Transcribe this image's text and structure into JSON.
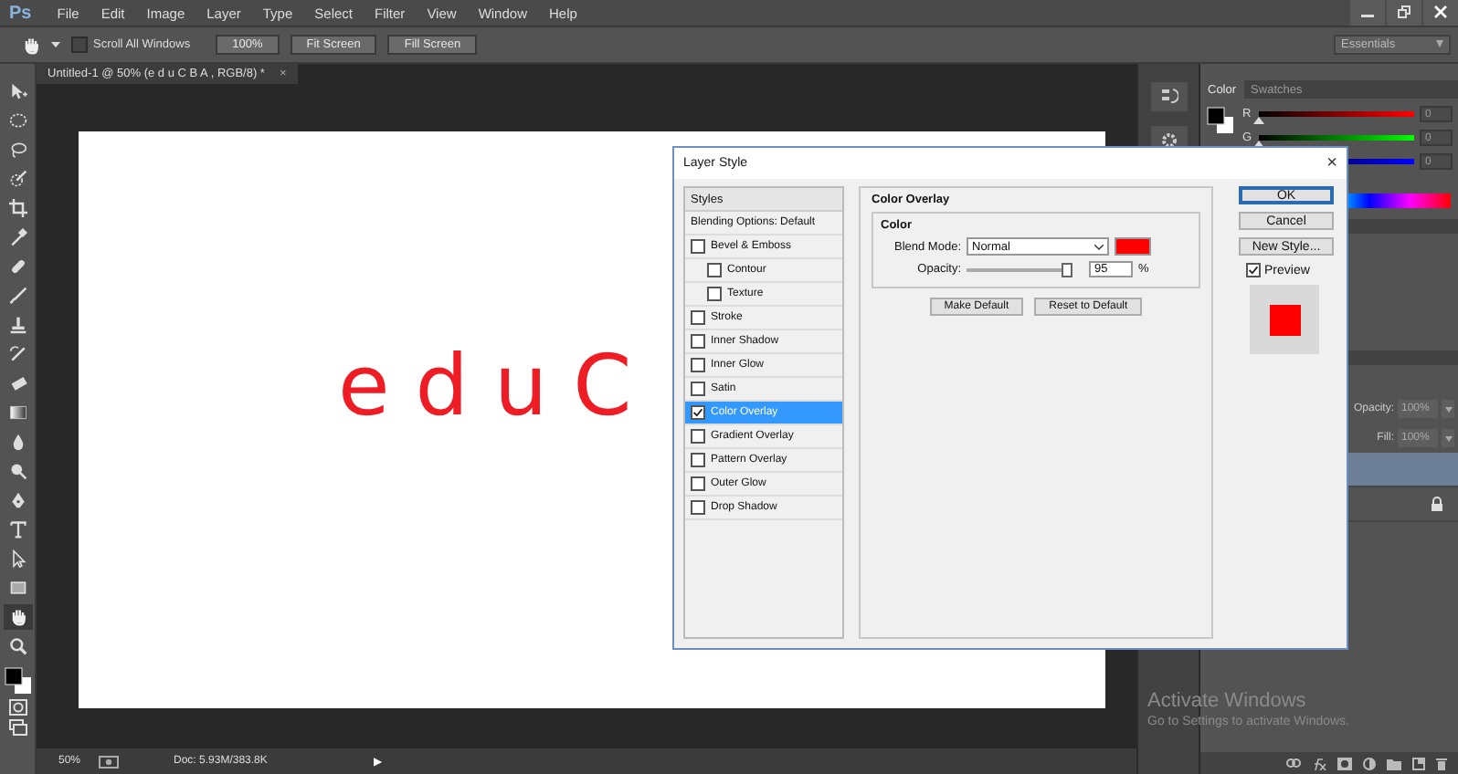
{
  "app": {
    "logo": "Ps"
  },
  "menu": [
    "File",
    "Edit",
    "Image",
    "Layer",
    "Type",
    "Select",
    "Filter",
    "View",
    "Window",
    "Help"
  ],
  "options_bar": {
    "scroll_all_windows": {
      "label": "Scroll All Windows",
      "checked": false
    },
    "buttons": [
      "100%",
      "Fit Screen",
      "Fill Screen"
    ],
    "workspace": "Essentials"
  },
  "document_tab": {
    "title": "Untitled-1 @ 50% (e d u C B A , RGB/8) *",
    "close": "×"
  },
  "tools": [
    {
      "kind": "move",
      "selected": false
    },
    {
      "kind": "marquee",
      "selected": false
    },
    {
      "kind": "lasso",
      "selected": false
    },
    {
      "kind": "quick-select",
      "selected": false
    },
    {
      "kind": "crop",
      "selected": false
    },
    {
      "kind": "eyedropper",
      "selected": false
    },
    {
      "kind": "healing",
      "selected": false
    },
    {
      "kind": "brush",
      "selected": false
    },
    {
      "kind": "stamp",
      "selected": false
    },
    {
      "kind": "history-brush",
      "selected": false
    },
    {
      "kind": "eraser",
      "selected": false
    },
    {
      "kind": "gradient",
      "selected": false
    },
    {
      "kind": "blur",
      "selected": false
    },
    {
      "kind": "dodge",
      "selected": false
    },
    {
      "kind": "pen",
      "selected": false
    },
    {
      "kind": "type",
      "selected": false
    },
    {
      "kind": "path-select",
      "selected": false
    },
    {
      "kind": "shape",
      "selected": false
    },
    {
      "kind": "hand",
      "selected": true
    },
    {
      "kind": "zoom",
      "selected": false
    }
  ],
  "canvas": {
    "text": "eduC"
  },
  "status_bar": {
    "zoom": "50%",
    "doc": "Doc: 5.93M/383.8K",
    "arrow": "▶"
  },
  "color_panel": {
    "tabs": [
      {
        "label": "Color",
        "selected": true
      },
      {
        "label": "Swatches",
        "selected": false
      }
    ],
    "channels": [
      {
        "label": "R",
        "level": 0,
        "value": "0"
      },
      {
        "label": "G",
        "level": 0,
        "value": "0"
      },
      {
        "level": 0,
        "value": "0"
      }
    ]
  },
  "layers_panel": {
    "opacity_label": "Opacity:",
    "opacity": "100%",
    "fill_label": "Fill:",
    "fill": "100%",
    "layers": [
      {
        "selected": true,
        "locked": false
      },
      {
        "selected": false,
        "locked": true
      }
    ]
  },
  "dialog": {
    "title": "Layer Style",
    "close": "×",
    "styles_header": "Styles",
    "blending_options": "Blending Options: Default",
    "effects": [
      {
        "label": "Bevel & Emboss",
        "checked": false,
        "selected": false,
        "children": [
          {
            "label": "Contour",
            "checked": false,
            "selected": false
          },
          {
            "label": "Texture",
            "checked": false,
            "selected": false
          }
        ]
      },
      {
        "label": "Stroke",
        "checked": false,
        "selected": false
      },
      {
        "label": "Inner Shadow",
        "checked": false,
        "selected": false
      },
      {
        "label": "Inner Glow",
        "checked": false,
        "selected": false
      },
      {
        "label": "Satin",
        "checked": false,
        "selected": false
      },
      {
        "label": "Color Overlay",
        "checked": true,
        "selected": true
      },
      {
        "label": "Gradient Overlay",
        "checked": false,
        "selected": false
      },
      {
        "label": "Pattern Overlay",
        "checked": false,
        "selected": false
      },
      {
        "label": "Outer Glow",
        "checked": false,
        "selected": false
      },
      {
        "label": "Drop Shadow",
        "checked": false,
        "selected": false
      }
    ],
    "section_title": "Color Overlay",
    "group_title": "Color",
    "blend_mode_label": "Blend Mode:",
    "blend_mode": "Normal",
    "opacity": {
      "label": "Opacity:",
      "level": 0.95,
      "value": "95",
      "unit": "%"
    },
    "buttons": [
      "Make Default",
      "Reset to Default"
    ],
    "side_buttons": [
      {
        "label": "OK",
        "default": true
      },
      {
        "label": "Cancel",
        "default": false
      },
      {
        "label": "New Style...",
        "default": false
      }
    ],
    "preview": {
      "label": "Preview",
      "checked": true
    }
  },
  "os_notice": {
    "title": "Activate Windows",
    "text": "Go to Settings to activate Windows."
  }
}
